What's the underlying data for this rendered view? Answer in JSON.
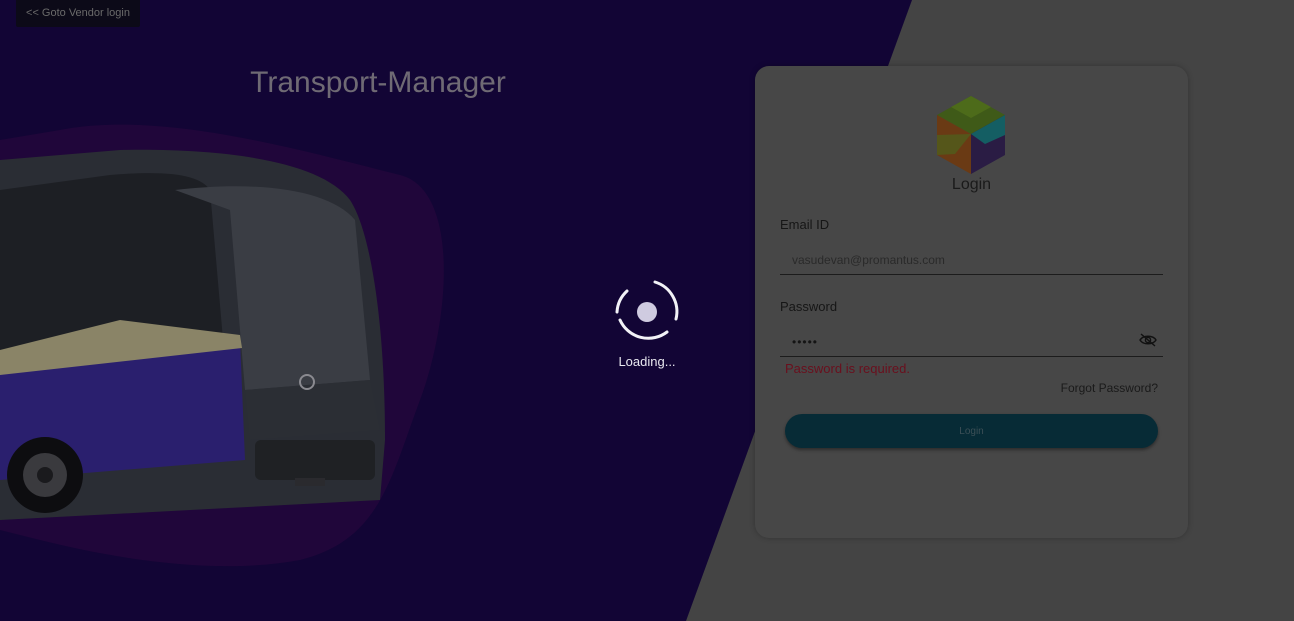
{
  "nav": {
    "vendor_link": "<< Goto Vendor login"
  },
  "hero": {
    "title": "Transport-Manager"
  },
  "login_form": {
    "heading": "Login",
    "email_label": "Email ID",
    "email_value": "vasudevan@promantus.com",
    "password_label": "Password",
    "password_value": "•••••",
    "error_message": "Password is required.",
    "forgot_link": "Forgot Password?",
    "submit_label": "Login"
  },
  "overlay": {
    "loading_text": "Loading..."
  },
  "colors": {
    "left_panel": "#120535",
    "right_panel": "#444444",
    "button": "#072b36",
    "error": "#6a0f1d"
  },
  "icons": [
    "app-logo-icon",
    "eye-off-icon",
    "spinner-icon"
  ]
}
